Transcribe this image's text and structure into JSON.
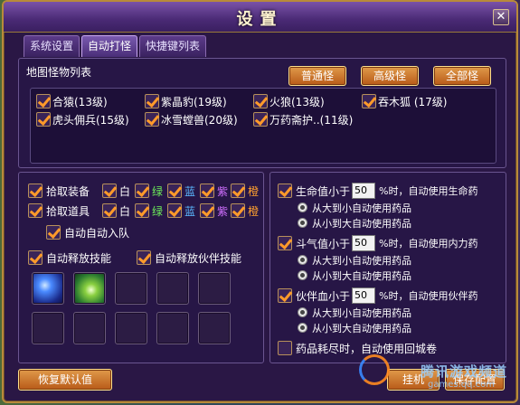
{
  "window": {
    "title": "设置"
  },
  "tabs": [
    {
      "label": "系统设置"
    },
    {
      "label": "自动打怪"
    },
    {
      "label": "快捷键列表"
    }
  ],
  "monster_panel": {
    "title": "地图怪物列表",
    "filter_buttons": [
      "普通怪",
      "高级怪",
      "全部怪"
    ],
    "monsters": [
      {
        "name": "合猿(13级)",
        "checked": true
      },
      {
        "name": "紫晶豹(19级)",
        "checked": true
      },
      {
        "name": "火狼(13级)",
        "checked": true
      },
      {
        "name": "吞木狐 (17级)",
        "checked": true
      },
      {
        "name": "虎头佣兵(15级)",
        "checked": true
      },
      {
        "name": "冰雪螳兽(20级)",
        "checked": true
      },
      {
        "name": "万药斋护..(11级)",
        "checked": true
      }
    ]
  },
  "pickup": {
    "equip_label": "拾取装备",
    "item_label": "拾取道具",
    "qualities": [
      "白",
      "绿",
      "蓝",
      "紫",
      "橙"
    ],
    "auto_join_team": "自动自动入队",
    "auto_skill": "自动释放技能",
    "auto_partner_skill": "自动释放伙伴技能"
  },
  "auto_potion": {
    "hp": {
      "label": "生命值小于",
      "value": "50",
      "suffix": "%时，自动使用生命药",
      "options": [
        "从大到小自动使用药品",
        "从小到大自动使用药品"
      ]
    },
    "mp": {
      "label": "斗气值小于",
      "value": "50",
      "suffix": "%时，自动使用内力药",
      "options": [
        "从大到小自动使用药品",
        "从小到大自动使用药品"
      ]
    },
    "partner": {
      "label": "伙伴血小于",
      "value": "50",
      "suffix": "%时，自动使用伙伴药",
      "options": [
        "从大到小自动使用药品",
        "从小到大自动使用药品"
      ]
    },
    "return_city": "药品耗尽时，自动使用回城卷"
  },
  "bottom": {
    "reset": "恢复默认值",
    "hang": "挂机",
    "save": "保存配置"
  },
  "watermark": {
    "main": "腾讯游戏频道",
    "sub": "games.qq.com"
  },
  "colors": {
    "white": "#ffffff",
    "green": "#6ef05a",
    "blue": "#5ab8ff",
    "purple": "#d070ff",
    "orange": "#ffa030"
  }
}
